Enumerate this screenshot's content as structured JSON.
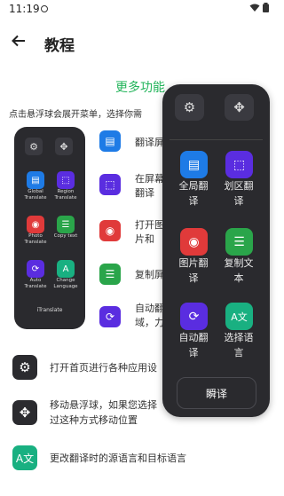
{
  "status": {
    "time": "11:19",
    "wifi_icon": "wifi-icon",
    "battery_icon": "battery-icon"
  },
  "header": {
    "back_icon": "arrow-left-icon",
    "title": "教程"
  },
  "section": {
    "title": "更多功能",
    "intro": "点击悬浮球会展开菜单，选择你需"
  },
  "mini_panel": {
    "items": [
      {
        "label": "Global Translate",
        "color": "#1e7be6",
        "icon": "global-icon"
      },
      {
        "label": "Region Translate",
        "color": "#5a2de0",
        "icon": "region-icon"
      },
      {
        "label": "Photo Translate",
        "color": "#e03a3a",
        "icon": "camera-icon"
      },
      {
        "label": "Copy text",
        "color": "#2aa54a",
        "icon": "copy-icon"
      },
      {
        "label": "Auto Translate",
        "color": "#5a2de0",
        "icon": "auto-icon"
      },
      {
        "label": "Change Language",
        "color": "#19b081",
        "icon": "language-icon"
      }
    ],
    "footer": "iTranslate"
  },
  "features": [
    {
      "text": "翻译屏",
      "color": "#1e7be6"
    },
    {
      "text": "在屏幕翻译",
      "color": "#5a2de0"
    },
    {
      "text": "打开图片和",
      "color": "#e03a3a"
    },
    {
      "text": "复制屏",
      "color": "#2aa54a"
    },
    {
      "text": "自动翻域，力",
      "color": "#5a2de0"
    }
  ],
  "bottom_list": [
    {
      "text": "打开首页进行各种应用设",
      "icon": "gear-icon"
    },
    {
      "text": "移动悬浮球，如果您选择",
      "text2": "过这种方式移动位置",
      "icon": "move-icon"
    },
    {
      "text": "更改翻译时的源语言和目标语言",
      "icon": "language-icon"
    }
  ],
  "float_panel": {
    "settings_icon": "gear-icon",
    "move_icon": "move-icon",
    "items": [
      {
        "label": "全局翻译",
        "color": "#1e7be6",
        "icon": "global-icon"
      },
      {
        "label": "划区翻译",
        "color": "#5a2de0",
        "icon": "region-icon"
      },
      {
        "label": "图片翻译",
        "color": "#e03a3a",
        "icon": "camera-icon"
      },
      {
        "label": "复制文本",
        "color": "#2aa54a",
        "icon": "copy-icon"
      },
      {
        "label": "自动翻译",
        "color": "#5a2de0",
        "icon": "auto-icon"
      },
      {
        "label": "选择语言",
        "color": "#19b081",
        "icon": "language-icon"
      }
    ],
    "translate_button": "瞬译"
  }
}
